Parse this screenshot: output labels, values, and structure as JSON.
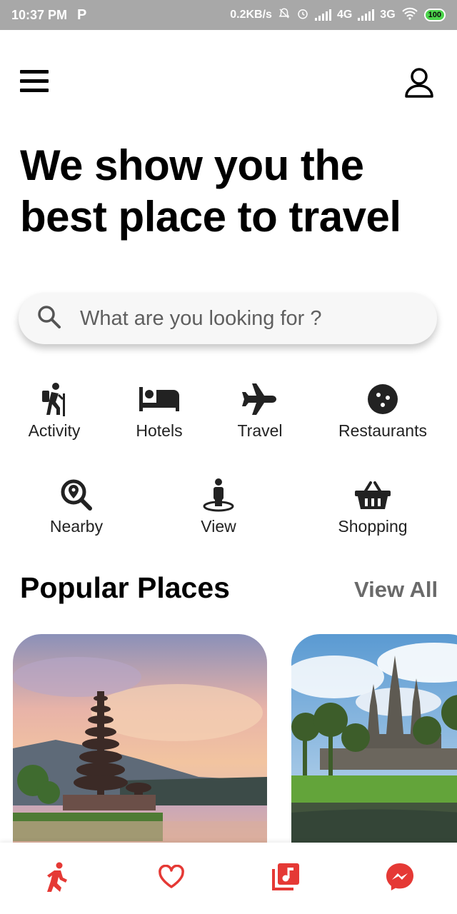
{
  "status_bar": {
    "time": "10:37 PM",
    "p_icon": "P",
    "speed": "0.2KB/s",
    "net1": "4G",
    "net2": "3G",
    "battery": "100"
  },
  "header": {
    "menu_icon": "hamburger-menu-icon",
    "profile_icon": "user-profile-icon"
  },
  "headline": {
    "line1": "We show you the",
    "line2": "best place to travel"
  },
  "search": {
    "placeholder": "What are you looking for ?",
    "icon": "search-icon"
  },
  "categories": [
    {
      "label": "Activity",
      "icon": "hiking-icon"
    },
    {
      "label": "Hotels",
      "icon": "bed-icon"
    },
    {
      "label": "Travel",
      "icon": "airplane-icon"
    },
    {
      "label": "Restaurants",
      "icon": "cookie-icon"
    },
    {
      "label": "Nearby",
      "icon": "location-search-icon"
    },
    {
      "label": "View",
      "icon": "street-view-icon"
    },
    {
      "label": "Shopping",
      "icon": "shopping-basket-icon"
    }
  ],
  "popular": {
    "title": "Popular Places",
    "view_all": "View All"
  },
  "bottom_nav": {
    "items": [
      "walking-icon",
      "heart-icon",
      "music-library-icon",
      "messenger-icon"
    ],
    "accent_color": "#e53935"
  }
}
